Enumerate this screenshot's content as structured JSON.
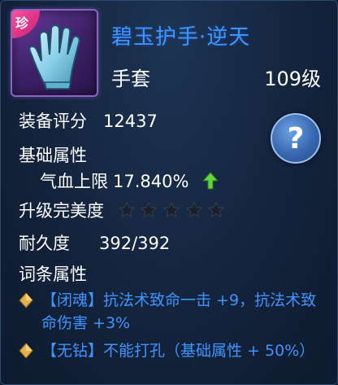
{
  "item": {
    "rarity_tag": "珍",
    "name": "碧玉护手·逆天",
    "type": "手套",
    "level": "109级",
    "icon": "glove-icon"
  },
  "stats": {
    "score_label": "装备评分",
    "score_value": "12437",
    "base_attr_title": "基础属性",
    "hp_label": "气血上限",
    "hp_value": "17.840%",
    "perfection_label": "升级完美度",
    "stars_total": 5,
    "stars_filled": 0,
    "durability_label": "耐久度",
    "durability_value": "392/392",
    "affix_title": "词条属性"
  },
  "affixes": [
    {
      "tag": "【闭魂】",
      "desc": "抗法术致命一击 +9，抗法术致命伤害 +3%"
    },
    {
      "tag": "【无钻】",
      "desc": "不能打孔（基础属性 + 50%）"
    }
  ],
  "help": {
    "label": "?"
  },
  "colors": {
    "name_blue": "#3f95ff",
    "arrow_green": "#5fd83a",
    "rarity_pink": "#ff4ea0",
    "star_dark": "#1a1f2a"
  }
}
